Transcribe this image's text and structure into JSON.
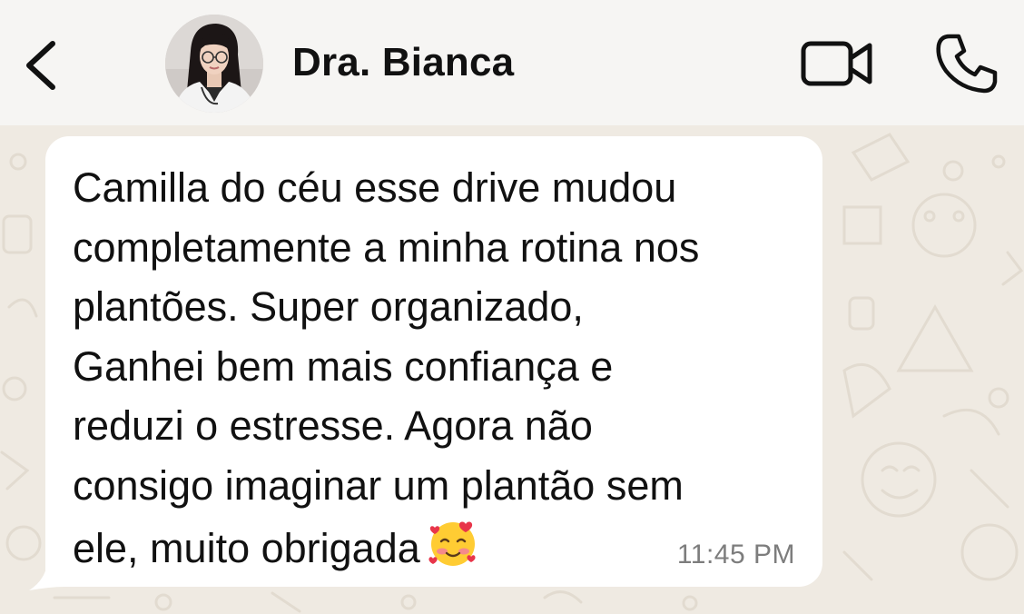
{
  "header": {
    "back_icon": "chevron-left-icon",
    "avatar": "profile-photo",
    "contact_name": "Dra. Bianca",
    "video_icon": "video-camera-icon",
    "call_icon": "phone-icon"
  },
  "message": {
    "lines": [
      "Camilla do céu esse drive mudou",
      "completamente a minha rotina nos",
      "plantões. Super organizado,",
      "Ganhei bem mais confiança e",
      "reduzi o estresse. Agora não",
      "consigo imaginar um plantão sem",
      "ele, muito obrigada"
    ],
    "emoji": "smiling-face-with-hearts",
    "time": "11:45 PM"
  },
  "colors": {
    "header_bg": "#f6f5f3",
    "chat_bg": "#efeae2",
    "bubble_bg": "#ffffff",
    "text": "#111111",
    "timestamp": "#7d7d7d"
  }
}
